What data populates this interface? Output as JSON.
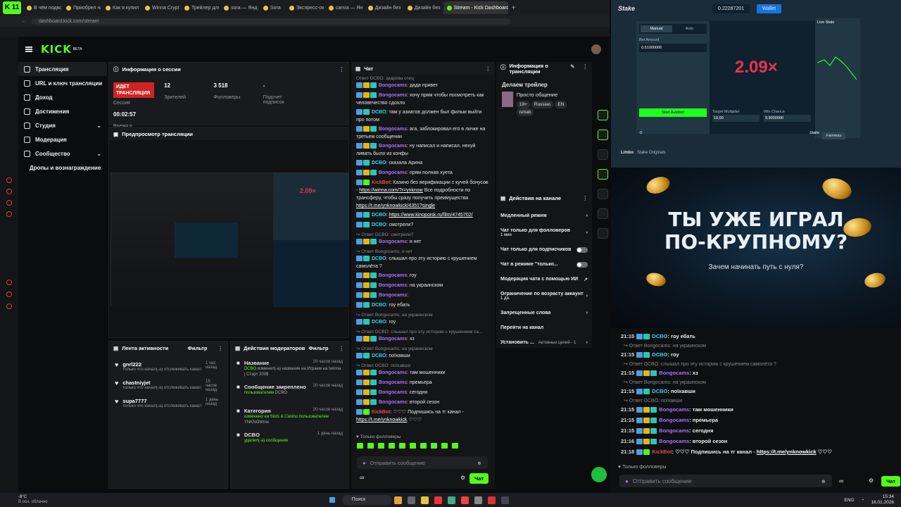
{
  "browser": {
    "tabs": [
      {
        "label": "В чём подво"
      },
      {
        "label": "Приобрел на"
      },
      {
        "label": "Как я купил"
      },
      {
        "label": "Winna Crypt"
      },
      {
        "label": "Трейлер для"
      },
      {
        "label": "sora — Янд"
      },
      {
        "label": "Sora"
      },
      {
        "label": "Экспресс-ок"
      },
      {
        "label": "canva — Ян"
      },
      {
        "label": "Дизайн без"
      },
      {
        "label": "Дизайн без"
      },
      {
        "label": "Stream - Kick Dashboard"
      }
    ],
    "url": "dashboard.kick.com/stream",
    "logo": "K 11"
  },
  "kick": {
    "logo": "KICK",
    "beta": "BETA",
    "sidebar": [
      {
        "label": "Трансляция",
        "icon": "broadcast-icon",
        "active": true
      },
      {
        "label": "URL и ключ трансляции",
        "icon": "key-icon"
      },
      {
        "label": "Доход",
        "icon": "money-icon"
      },
      {
        "label": "Достижения",
        "icon": "trophy-icon"
      },
      {
        "label": "Студия",
        "icon": "studio-icon",
        "chevron": true
      },
      {
        "label": "Модерация",
        "icon": "moderation-icon"
      },
      {
        "label": "Сообщество",
        "icon": "community-icon",
        "chevron": true
      },
      {
        "label": "Дропы и вознаграждение",
        "icon": ""
      }
    ],
    "session": {
      "title": "Информация о сессии",
      "live_badge": "ИДЕТ ТРАНСЛЯЦИЯ",
      "session_label": "Сессия",
      "viewers": "12",
      "viewers_label": "Зрителей",
      "followers": "3 518",
      "followers_label": "Фолловеры",
      "subs": "-",
      "subs_label": "Подсчет подписок",
      "time": "00:02:57",
      "time_label": "Время в прямом эфире"
    },
    "preview_title": "Предпросмотр трансляции",
    "activity": {
      "title": "Лента активности",
      "filter": "Фильтр",
      "items": [
        {
          "name": "gnrl222",
          "sub": "только что начал(-а) отслеживать канал",
          "time": "1 час назад"
        },
        {
          "name": "chastniyjet",
          "sub": "только что начал(-а) отслеживать канал",
          "time": "15 часов назад"
        },
        {
          "name": "supa7777",
          "sub": "только что начал(-а) отслеживать канал",
          "time": "1 день назад"
        }
      ]
    },
    "modactions": {
      "title": "Действия модераторов",
      "filter": "Фильтр",
      "items": [
        {
          "title": "Название",
          "time": "20 часов назад",
          "line1": "DCBO",
          "line2": "изменил(-а) название на Играем на Iwinna | Старт 200$"
        },
        {
          "title": "Сообщение закреплено",
          "time": "20 часов назад",
          "line1": "пользователем",
          "line2": "DCBO"
        },
        {
          "title": "Категория",
          "time": "20 часов назад",
          "line1": "изменено на Slots & Casino пользователем",
          "line2": "YNKNOWme"
        },
        {
          "title": "DCBO",
          "time": "1 день назад",
          "line1": "удалил(-а) сообщение",
          "line2": ""
        }
      ]
    },
    "chat": {
      "title": "Чат",
      "top_reply": "Ответ DCBO: здарова отец",
      "messages": [
        {
          "reply": "",
          "user": "Bongocams",
          "u": "un1",
          "text": ": дада привет"
        },
        {
          "reply": "",
          "user": "Bongocams",
          "u": "un1",
          "text": ": хочу прям чтобы посмотреть как человечество сдохло"
        },
        {
          "reply": "",
          "user": "DCBO",
          "u": "un2",
          "text": ": там у азиатов должен был фильм выйти про потом"
        },
        {
          "reply": "",
          "user": "Bongocams",
          "u": "un1",
          "text": ": ага, заблокировал его в личке на третьем сообщении"
        },
        {
          "reply": "",
          "user": "Bongocams",
          "u": "un1",
          "text": ": ну написал и написал, нехуй ливать было из конфы"
        },
        {
          "reply": "",
          "user": "DCBO",
          "u": "un2",
          "text": ": сказала Арина"
        },
        {
          "reply": "",
          "user": "Bongocams",
          "u": "un1",
          "text": ": прям полная хуета"
        },
        {
          "reply": "",
          "user": "KickBot",
          "u": "un3",
          "text": ": Казино без верификации с кучей бонусов - https://winna.com/?r=ynknow Все подробности по трансферу, чтобы сразу получить преимущества https://t.me/ynknowkick/4351?single"
        },
        {
          "reply": "",
          "user": "DCBO",
          "u": "un2",
          "text": ": https://www.kinopoisk.ru/film/4745702/"
        },
        {
          "reply": "",
          "user": "DCBO",
          "u": "un2",
          "text": ": смотрели?"
        },
        {
          "reply": "Ответ DCBO: смотрели?",
          "user": "Bongocams",
          "u": "un1",
          "text": ": я нет"
        },
        {
          "reply": "Ответ Bongocams: я нет",
          "user": "DCBO",
          "u": "un2",
          "text": ": слышал про эту историю с крушением самолёта ?"
        },
        {
          "reply": "",
          "user": "Bongocams",
          "u": "un1",
          "text": ": гоу"
        },
        {
          "reply": "",
          "user": "Bongocams",
          "u": "un1",
          "text": ": на украинском"
        },
        {
          "reply": "",
          "user": "Bongocams",
          "u": "un1",
          "text": ":"
        },
        {
          "reply": "",
          "user": "DCBO",
          "u": "un2",
          "text": ": гоу ебать"
        },
        {
          "reply": "Ответ Bongocams: на украинском",
          "user": "DCBO",
          "u": "un2",
          "text": ": гоу"
        },
        {
          "reply": "Ответ DCBO: слышал про эту историю с крушением са...",
          "user": "Bongocams",
          "u": "un1",
          "text": ": хз"
        },
        {
          "reply": "Ответ Bongocams: на украинском",
          "user": "DCBO",
          "u": "un2",
          "text": ": поїхавши"
        },
        {
          "reply": "Ответ DCBO: поїхавши",
          "user": "Bongocams",
          "u": "un1",
          "text": ": там мошенники"
        },
        {
          "reply": "",
          "user": "Bongocams",
          "u": "un1",
          "text": ": премьера"
        },
        {
          "reply": "",
          "user": "Bongocams",
          "u": "un1",
          "text": ": сегодня"
        },
        {
          "reply": "",
          "user": "Bongocams",
          "u": "un1",
          "text": ": второй сезон"
        },
        {
          "reply": "",
          "user": "KickBot",
          "u": "un3",
          "text": ": ♡♡♡ Подпишись на тг канал - https://t.me/ynknowkick ♡♡♡"
        }
      ],
      "followers_only": "Только фолловеры",
      "input_placeholder": "Отправить сообщение",
      "send": "Чат"
    },
    "stream_info": {
      "title": "Информация о трансляции",
      "trailer": "Делаем трейлер",
      "category": "Просто общение",
      "tags": [
        "18+",
        "Russian",
        "EN",
        "rehab"
      ]
    },
    "channel_actions": {
      "title": "Действия на канале",
      "items": [
        {
          "label": "Медленный режим",
          "sub": "",
          "kind": "chev"
        },
        {
          "label": "Чат только для фолловеров",
          "sub": "1 мин",
          "kind": "chev"
        },
        {
          "label": "Чат только для подписчиков",
          "sub": "",
          "kind": "toggle"
        },
        {
          "label": "Чат в режиме \"только...",
          "sub": "",
          "kind": "toggle"
        },
        {
          "label": "Модерация чата с помощью ИИ",
          "sub": "",
          "kind": "ext"
        },
        {
          "label": "Ограничение по возрасту аккаунта",
          "sub": "1 дн.",
          "kind": "chev"
        },
        {
          "label": "Запрещенные слова",
          "sub": "",
          "kind": "chev"
        },
        {
          "label": "Перейти на канал",
          "sub": "",
          "kind": "none"
        },
        {
          "label": "Установить ...",
          "sub": "Активных целей - 1",
          "kind": "chev"
        }
      ]
    }
  },
  "overlay": {
    "stake": {
      "logo": "Stake",
      "balance": "0.22287201",
      "wallet": "Wallet",
      "multiplier": "2.09×",
      "manual": "Manual",
      "auto": "Auto",
      "bet_amount_label": "Bet Amount",
      "bet_amount": "0.51000000",
      "start": "Start Autobet",
      "target_label": "Target Multiplier",
      "target": "10,00",
      "chance_label": "Win Chance",
      "chance": "9,9000000",
      "live_stats": "Live Stats",
      "fairness": "Fairness",
      "limbo": "Limbo",
      "originals": "Stake Originals"
    },
    "promo": {
      "headline1": "ТЫ УЖЕ ИГРАЛ",
      "headline2": "ПО-КРУПНОМУ?",
      "sub": "Зачем начинать путь с нуля?"
    },
    "chat": {
      "rows": [
        {
          "reply": "",
          "time": "21:15",
          "user": "DCBO",
          "u": "un2",
          "text": ": гоу ебать"
        },
        {
          "reply": "Ответ Bongocams: на украинском",
          "time": "21:15",
          "user": "DCBO",
          "u": "un2",
          "text": ": гоу"
        },
        {
          "reply": "Ответ DCBO: слышал про эту историю с крушением самолёта ?",
          "time": "21:15",
          "user": "Bongocams",
          "u": "un1",
          "text": ": хз"
        },
        {
          "reply": "Ответ Bongocams: на украинском",
          "time": "21:15",
          "user": "DCBO",
          "u": "un2",
          "text": ": поїхавши"
        },
        {
          "reply": "Ответ DCBO: поїхавши",
          "time": "21:15",
          "user": "Bongocams",
          "u": "un1",
          "text": ": там мошенники"
        },
        {
          "reply": "",
          "time": "21:15",
          "user": "Bongocams",
          "u": "un1",
          "text": ": премьера"
        },
        {
          "reply": "",
          "time": "21:15",
          "user": "Bongocams",
          "u": "un1",
          "text": ": сегодня"
        },
        {
          "reply": "",
          "time": "21:16",
          "user": "Bongocams",
          "u": "un1",
          "text": ": второй сезон"
        },
        {
          "reply": "",
          "time": "21:18",
          "user": "KickBot",
          "u": "un3",
          "text": ": ♡♡♡ Подпишись на тг канал - https://t.me/ynknowkick ♡♡♡"
        }
      ],
      "followers_only": "Только фолловеры",
      "input_placeholder": "Отправить сообщение",
      "send": "Чат"
    }
  },
  "taskbar": {
    "weather_temp": "-8°C",
    "weather_desc": "В осн. облачно",
    "search": "Поиск",
    "lang": "ENG",
    "time": "15:34",
    "date": "16.01.2026"
  },
  "colors": {
    "kick_green": "#53fc18",
    "live_red": "#d02323",
    "stake_bg": "#1a2c38",
    "mult_red": "#e8344e"
  }
}
